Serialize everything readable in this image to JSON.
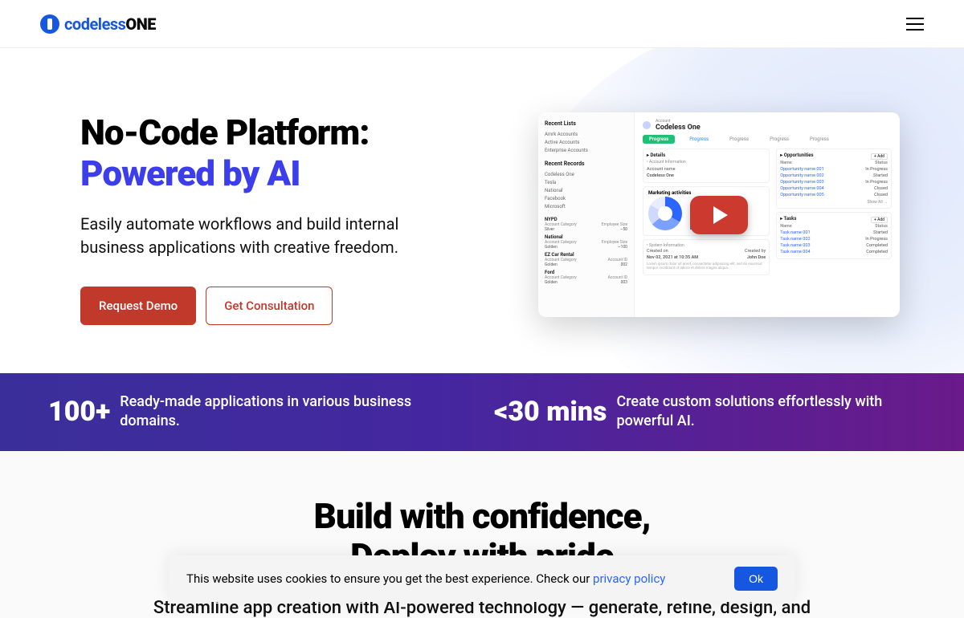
{
  "brand": {
    "name_thin": "codeless",
    "name_bold": "ONE"
  },
  "hero": {
    "title_line1": "No-Code Platform:",
    "title_line2": "Powered by AI",
    "subtitle": "Easily automate workflows and build internal business applications with creative freedom.",
    "cta_primary": "Request Demo",
    "cta_secondary": "Get Consultation"
  },
  "video_preview": {
    "sidebar": {
      "section1_title": "Recent Lists",
      "section1_items": [
        "Amrk Accounts",
        "Active Accounts",
        "Enterprise Accounts"
      ],
      "section2_title": "Recent Records",
      "section2_items": [
        "Codeless One",
        "Tesla",
        "National",
        "Facebook",
        "Microsoft"
      ],
      "section3_items": [
        {
          "name": "NYPD",
          "l1": "Account Category",
          "l2": "Silver",
          "r1": "Employee Size",
          "r2": "~50"
        },
        {
          "name": "National",
          "l1": "Account Category",
          "l2": "Golden",
          "r1": "Employee Size",
          "r2": "~100"
        },
        {
          "name": "EZ Car Rental",
          "l1": "Account Category",
          "l2": "Golden",
          "r1": "Account ID",
          "r2": "002"
        },
        {
          "name": "Ford",
          "l1": "Account Category",
          "l2": "Golden",
          "r1": "Account ID",
          "r2": "003"
        }
      ]
    },
    "main": {
      "account_label": "Account",
      "account_name": "Codeless One",
      "tabs": [
        "Progress",
        "Progress",
        "Progress",
        "Progress",
        "Progress"
      ],
      "details_title": "Details",
      "details_sub": "Account Information",
      "details_rows": [
        [
          "Account name",
          ""
        ],
        [
          "Codeless One",
          ""
        ]
      ],
      "marketing_title": "Marketing activities",
      "system_title": "System Information",
      "system_rows": [
        [
          "Created on",
          "Created by"
        ],
        [
          "Nov 02, 2021 at 10:35 AM",
          "John Doe"
        ]
      ],
      "opportunities": {
        "title": "Opportunities",
        "add": "+ Add",
        "cols": [
          "Name",
          "Status"
        ],
        "rows": [
          [
            "Opportunity name 001",
            "In Progress"
          ],
          [
            "Opportunity name 002",
            "Started"
          ],
          [
            "Opportunity name 003",
            "In Progress"
          ],
          [
            "Opportunity name 004",
            "Closed"
          ],
          [
            "Opportunity name 005",
            "Closed"
          ]
        ],
        "show_all": "Show All →"
      },
      "tasks": {
        "title": "Tasks",
        "add": "+ Add",
        "cols": [
          "Name",
          "Status"
        ],
        "rows": [
          [
            "Task name 001",
            "Started"
          ],
          [
            "Task name 002",
            "In Progress"
          ],
          [
            "Task name 003",
            "Completed"
          ],
          [
            "Task name 004",
            "Completed"
          ]
        ]
      }
    }
  },
  "stats": [
    {
      "num": "100+",
      "text": "Ready-made applications in various business domains."
    },
    {
      "num": "<30 mins",
      "text": "Create custom solutions effortlessly with powerful AI."
    }
  ],
  "build": {
    "title_l1": "Build with confidence,",
    "title_l2": "Deploy with pride",
    "sub": "Streamline app creation with AI-powered technology — generate, refine, design, and"
  },
  "cookie": {
    "text": "This website uses cookies to ensure you get the best experience. Check our ",
    "link": "privacy policy",
    "ok": "Ok"
  }
}
